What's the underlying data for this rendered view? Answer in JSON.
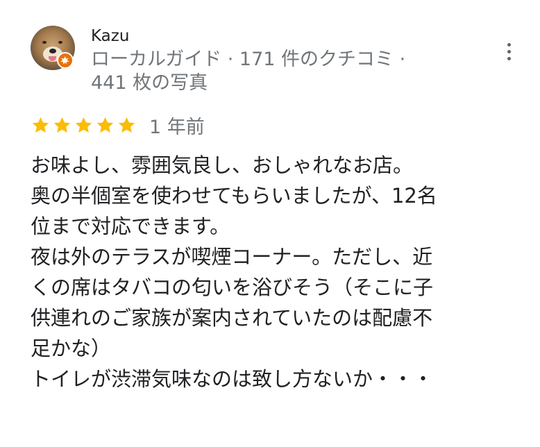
{
  "reviewer": {
    "name": "Kazu",
    "meta_line1": "ローカルガイド · 171 件のクチコミ ·",
    "meta_line2": "441 枚の写真",
    "avatar_icon": "dog-avatar",
    "badge_icon": "local-guide-star-icon",
    "badge_color": "#e8710a"
  },
  "menu": {
    "icon": "more-vert-icon"
  },
  "rating": {
    "stars": 5,
    "max_stars": 5,
    "star_color": "#fbbc04",
    "date": "1 年前"
  },
  "review": {
    "lines": [
      "お味よし、雰囲気良し、おしゃれなお店。",
      "奥の半個室を使わせてもらいましたが、12名",
      "位まで対応できます。",
      "夜は外のテラスが喫煙コーナー。ただし、近",
      "くの席はタバコの匂いを浴びそう（そこに子",
      "供連れのご家族が案内されていたのは配慮不",
      "足かな）",
      "トイレが渋滞気味なのは致し方ないか・・・"
    ]
  }
}
